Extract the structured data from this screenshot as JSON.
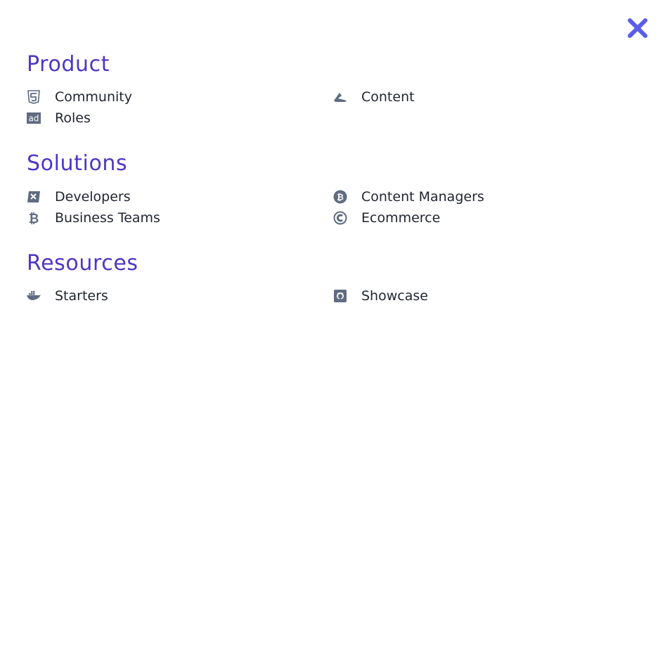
{
  "menu": {
    "close_icon": "close-icon",
    "accent_color": "#4c37c5",
    "icon_color": "#5f6b80",
    "close_color": "#5b5ce8"
  },
  "sections": [
    {
      "title": "Product",
      "items": [
        {
          "label": "Community",
          "icon": "html5-icon"
        },
        {
          "label": "Content",
          "icon": "kickstarter-k-icon"
        },
        {
          "label": "Roles",
          "icon": "ad-icon"
        }
      ]
    },
    {
      "title": "Solutions",
      "items": [
        {
          "label": "Developers",
          "icon": "edit-square-icon"
        },
        {
          "label": "Content Managers",
          "icon": "bitcoin-circle-icon"
        },
        {
          "label": "Business Teams",
          "icon": "bitcoin-icon"
        },
        {
          "label": "Ecommerce",
          "icon": "creative-commons-icon"
        }
      ]
    },
    {
      "title": "Resources",
      "items": [
        {
          "label": "Starters",
          "icon": "docker-icon"
        },
        {
          "label": "Showcase",
          "icon": "github-square-icon"
        }
      ]
    }
  ]
}
